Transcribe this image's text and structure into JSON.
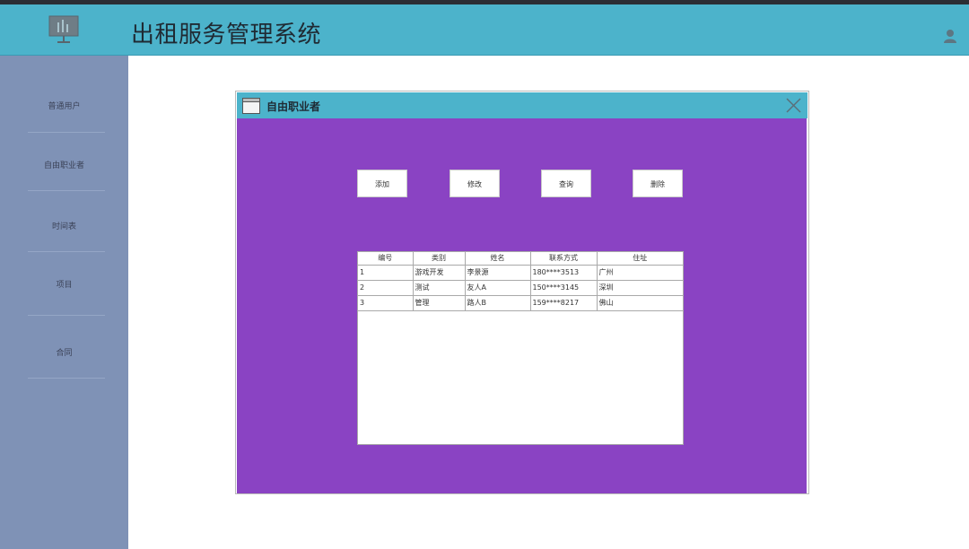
{
  "header": {
    "title": "出租服务管理系统",
    "logo_icon": "presentation-board-icon",
    "user_icon": "user-icon",
    "bg_color": "#4cb3cb"
  },
  "sidebar": {
    "bg_color": "#7f92b6",
    "items": [
      {
        "label": "普通用户"
      },
      {
        "label": "自由职业者"
      },
      {
        "label": "时间表"
      },
      {
        "label": "项目"
      },
      {
        "label": "合同"
      }
    ]
  },
  "dialog": {
    "title": "自由职业者",
    "body_color": "#8a43c3",
    "buttons": {
      "add": "添加",
      "edit": "修改",
      "query": "查询",
      "delete": "删除"
    },
    "table": {
      "columns": [
        "编号",
        "类别",
        "姓名",
        "联系方式",
        "住址"
      ],
      "rows": [
        [
          "1",
          "游戏开发",
          "李景源",
          "180****3513",
          "广州"
        ],
        [
          "2",
          "测试",
          "友人A",
          "150****3145",
          "深圳"
        ],
        [
          "3",
          "管理",
          "路人B",
          "159****8217",
          "佛山"
        ]
      ]
    }
  }
}
